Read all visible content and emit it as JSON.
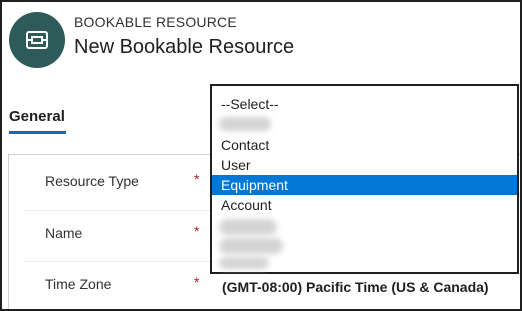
{
  "header": {
    "entity_type": "BOOKABLE RESOURCE",
    "title": "New Bookable Resource",
    "icon": "bookable-resource-icon"
  },
  "tabs": [
    {
      "label": "General",
      "active": true
    }
  ],
  "form": {
    "fields": [
      {
        "label": "Resource Type",
        "required": "*",
        "value": ""
      },
      {
        "label": "Name",
        "required": "*",
        "value": ""
      },
      {
        "label": "Time Zone",
        "required": "*",
        "value": "(GMT-08:00) Pacific Time (US & Canada)"
      }
    ]
  },
  "resource_type_dropdown": {
    "options": [
      "--Select--",
      "Contact",
      "User",
      "Equipment",
      "Account"
    ],
    "highlighted": "Equipment"
  },
  "colors": {
    "accent": "#0f6cbd",
    "selection": "#0078d4",
    "icon_bg": "#2e5a5a",
    "required": "#a4262c"
  }
}
